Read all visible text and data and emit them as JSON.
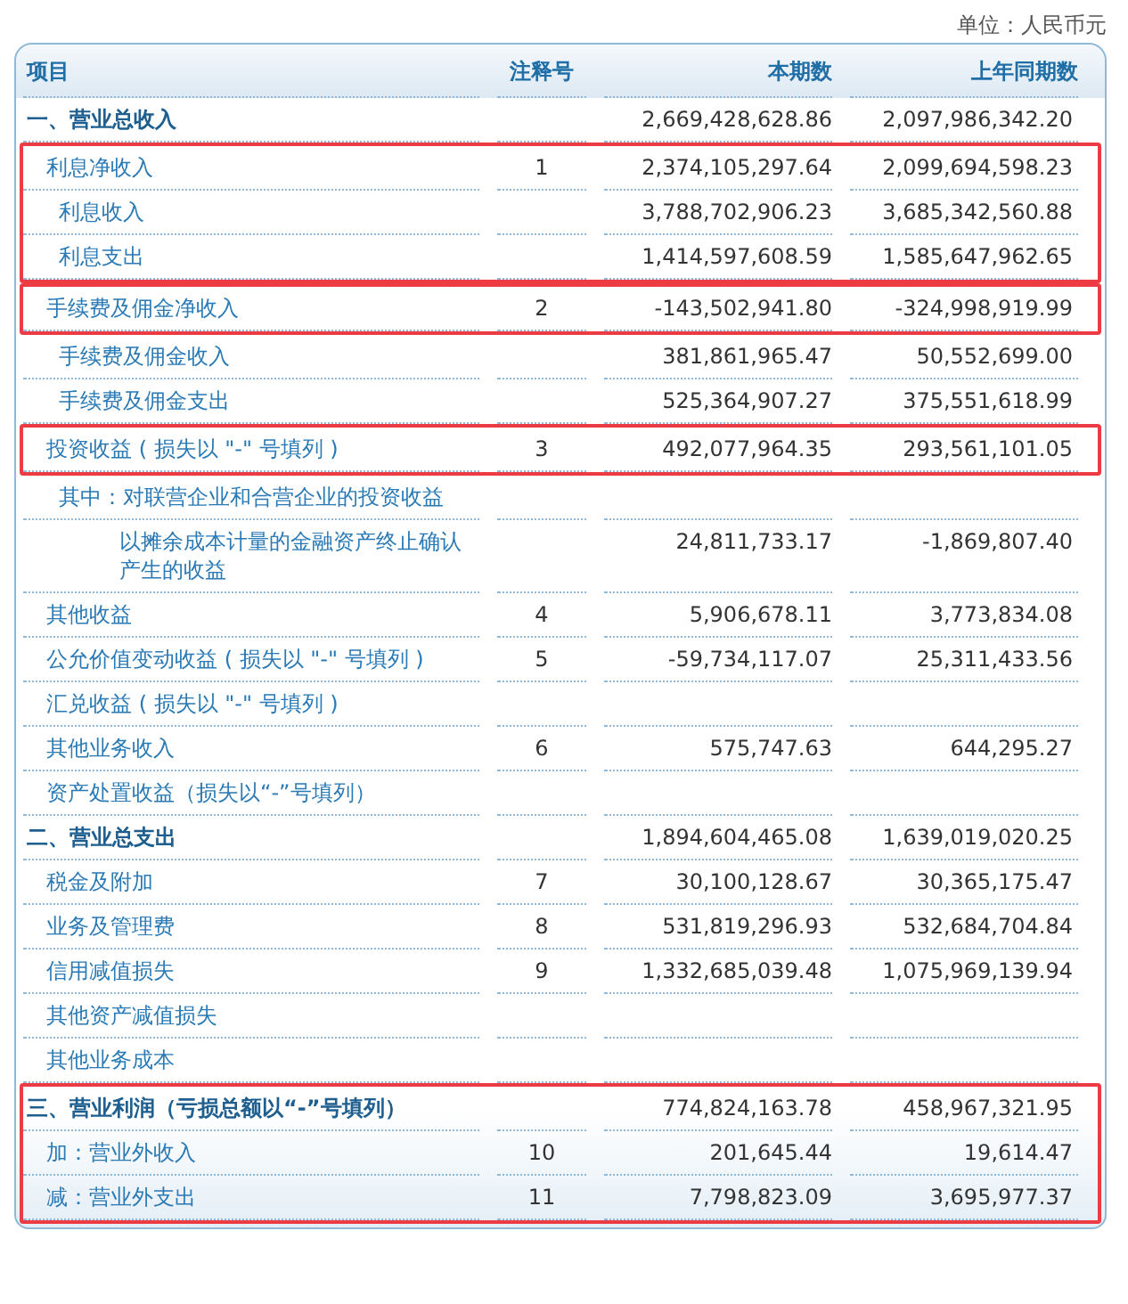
{
  "unit_label": "单位：人民币元",
  "columns": [
    "项目",
    "注释号",
    "本期数",
    "上年同期数"
  ],
  "rows": [
    {
      "kind": "section",
      "label": "一、营业总收入",
      "highlighted": false,
      "current": "2,669,428,628.86",
      "prior": "2,097,986,342.20",
      "children": [
        {
          "kind": "item",
          "label": "利息净收入",
          "note": "1",
          "highlighted": true,
          "current": "2,374,105,297.64",
          "prior": "2,099,694,598.23",
          "children": [
            {
              "kind": "item",
              "label": "利息收入",
              "highlighted": true,
              "current": "3,788,702,906.23",
              "prior": "3,685,342,560.88"
            },
            {
              "kind": "item",
              "label": "利息支出",
              "highlighted": true,
              "current": "1,414,597,608.59",
              "prior": "1,585,647,962.65"
            }
          ]
        },
        {
          "kind": "item",
          "label": "手续费及佣金净收入",
          "note": "2",
          "highlighted": true,
          "current": "-143,502,941.80",
          "prior": "-324,998,919.99",
          "children": [
            {
              "kind": "item",
              "label": "手续费及佣金收入",
              "highlighted": false,
              "current": "381,861,965.47",
              "prior": "50,552,699.00"
            },
            {
              "kind": "item",
              "label": "手续费及佣金支出",
              "highlighted": false,
              "current": "525,364,907.27",
              "prior": "375,551,618.99"
            }
          ]
        },
        {
          "kind": "item",
          "label": "投资收益 ( 损失以 \"-\" 号填列 )",
          "note": "3",
          "highlighted": true,
          "current": "492,077,964.35",
          "prior": "293,561,101.05",
          "children": [
            {
              "kind": "item",
              "label": "其中：对联营企业和合营企业的投资收益",
              "highlighted": false,
              "children": [
                {
                  "kind": "item",
                  "label": "以摊余成本计量的金融资产终止确认产生的收益",
                  "highlighted": false,
                  "current": "24,811,733.17",
                  "prior": "-1,869,807.40"
                }
              ]
            }
          ]
        },
        {
          "kind": "item",
          "label": "其他收益",
          "note": "4",
          "highlighted": false,
          "current": "5,906,678.11",
          "prior": "3,773,834.08"
        },
        {
          "kind": "item",
          "label": "公允价值变动收益 ( 损失以 \"-\" 号填列 )",
          "note": "5",
          "highlighted": false,
          "current": "-59,734,117.07",
          "prior": "25,311,433.56"
        },
        {
          "kind": "item",
          "label": "汇兑收益 ( 损失以 \"-\" 号填列 )",
          "highlighted": false
        },
        {
          "kind": "item",
          "label": "其他业务收入",
          "note": "6",
          "highlighted": false,
          "current": "575,747.63",
          "prior": "644,295.27"
        },
        {
          "kind": "item",
          "label": "资产处置收益（损失以“-”号填列）",
          "highlighted": false
        }
      ]
    },
    {
      "kind": "section",
      "label": "二、营业总支出",
      "highlighted": false,
      "current": "1,894,604,465.08",
      "prior": "1,639,019,020.25",
      "children": [
        {
          "kind": "item",
          "label": "税金及附加",
          "note": "7",
          "highlighted": false,
          "current": "30,100,128.67",
          "prior": "30,365,175.47"
        },
        {
          "kind": "item",
          "label": "业务及管理费",
          "note": "8",
          "highlighted": false,
          "current": "531,819,296.93",
          "prior": "532,684,704.84"
        },
        {
          "kind": "item",
          "label": "信用减值损失",
          "note": "9",
          "highlighted": false,
          "current": "1,332,685,039.48",
          "prior": "1,075,969,139.94"
        },
        {
          "kind": "item",
          "label": "其他资产减值损失",
          "highlighted": false
        },
        {
          "kind": "item",
          "label": "其他业务成本",
          "highlighted": false
        }
      ]
    },
    {
      "kind": "section",
      "label": "三、营业利润（亏损总额以“-”号填列）",
      "highlighted": true,
      "current": "774,824,163.78",
      "prior": "458,967,321.95",
      "children": [
        {
          "kind": "item",
          "label": "加：营业外收入",
          "note": "10",
          "highlighted": true,
          "current": "201,645.44",
          "prior": "19,614.47"
        },
        {
          "kind": "item",
          "label": "减：营业外支出",
          "note": "11",
          "highlighted": true,
          "current": "7,798,823.09",
          "prior": "3,695,977.37"
        }
      ]
    }
  ]
}
